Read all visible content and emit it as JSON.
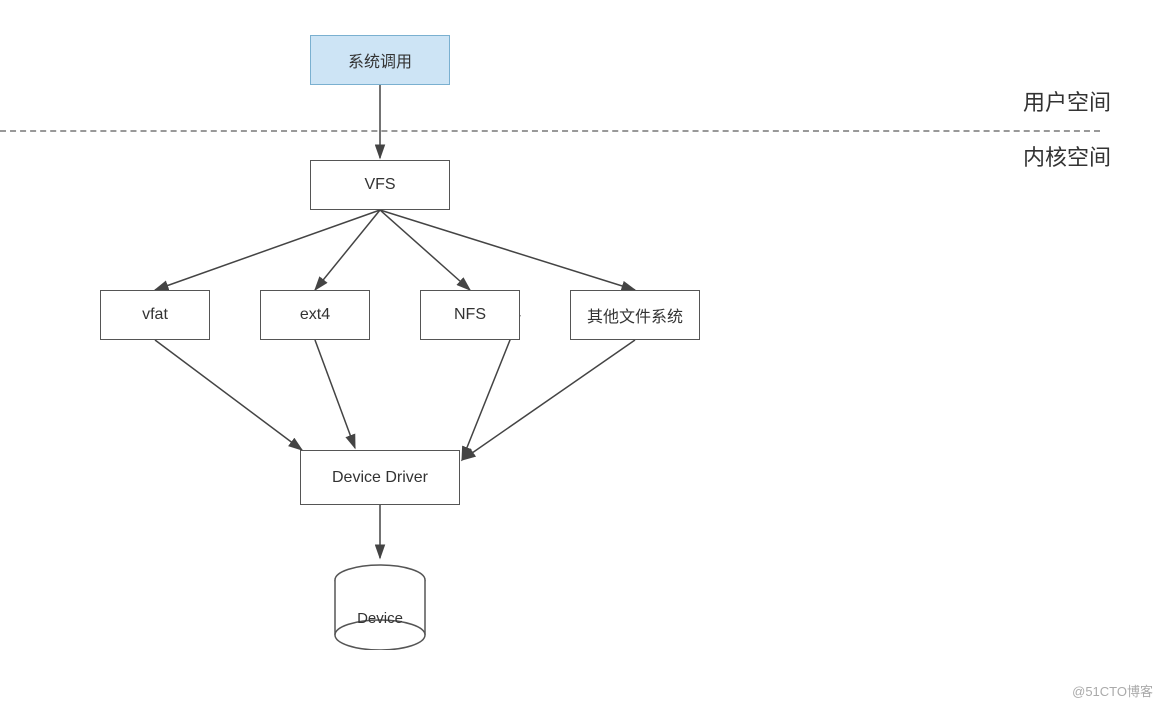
{
  "labels": {
    "user_space": "用户空间",
    "kernel_space": "内核空间",
    "syscall": "系统调用",
    "vfs": "VFS",
    "vfat": "vfat",
    "ext4": "ext4",
    "nfs": "NFS",
    "other": "其他文件系统",
    "driver": "Device Driver",
    "device": "Device",
    "watermark": "@51CTO博客"
  },
  "colors": {
    "box_fill": "#ffffff",
    "box_stroke": "#555555",
    "syscall_fill": "#cde4f5",
    "syscall_stroke": "#7ab0d0",
    "arrow": "#444444"
  }
}
